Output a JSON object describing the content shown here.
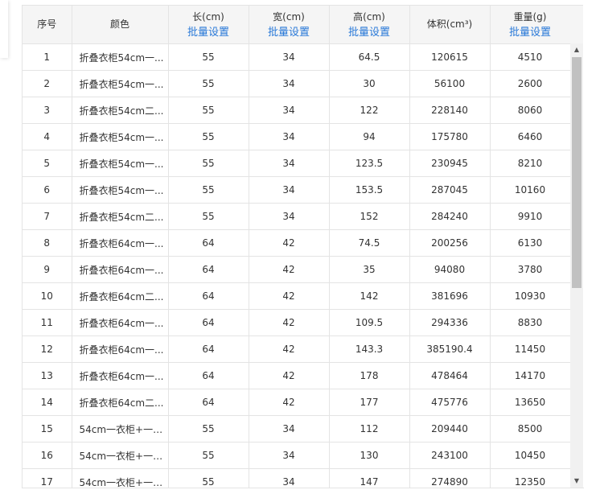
{
  "header": {
    "index": "序号",
    "color": "颜色",
    "length": "长(cm)",
    "width": "宽(cm)",
    "height": "高(cm)",
    "volume": "体积(cm³)",
    "weight": "重量(g)",
    "batch_label": "批量设置"
  },
  "rows": [
    {
      "index": "1",
      "color": "折叠衣柜54cm一...",
      "length": "55",
      "width": "34",
      "height": "64.5",
      "volume": "120615",
      "weight": "4510"
    },
    {
      "index": "2",
      "color": "折叠衣柜54cm一...",
      "length": "55",
      "width": "34",
      "height": "30",
      "volume": "56100",
      "weight": "2600"
    },
    {
      "index": "3",
      "color": "折叠衣柜54cm二...",
      "length": "55",
      "width": "34",
      "height": "122",
      "volume": "228140",
      "weight": "8060"
    },
    {
      "index": "4",
      "color": "折叠衣柜54cm一...",
      "length": "55",
      "width": "34",
      "height": "94",
      "volume": "175780",
      "weight": "6460"
    },
    {
      "index": "5",
      "color": "折叠衣柜54cm一...",
      "length": "55",
      "width": "34",
      "height": "123.5",
      "volume": "230945",
      "weight": "8210"
    },
    {
      "index": "6",
      "color": "折叠衣柜54cm一...",
      "length": "55",
      "width": "34",
      "height": "153.5",
      "volume": "287045",
      "weight": "10160"
    },
    {
      "index": "7",
      "color": "折叠衣柜54cm二...",
      "length": "55",
      "width": "34",
      "height": "152",
      "volume": "284240",
      "weight": "9910"
    },
    {
      "index": "8",
      "color": "折叠衣柜64cm一...",
      "length": "64",
      "width": "42",
      "height": "74.5",
      "volume": "200256",
      "weight": "6130"
    },
    {
      "index": "9",
      "color": "折叠衣柜64cm一...",
      "length": "64",
      "width": "42",
      "height": "35",
      "volume": "94080",
      "weight": "3780"
    },
    {
      "index": "10",
      "color": "折叠衣柜64cm二...",
      "length": "64",
      "width": "42",
      "height": "142",
      "volume": "381696",
      "weight": "10930"
    },
    {
      "index": "11",
      "color": "折叠衣柜64cm一...",
      "length": "64",
      "width": "42",
      "height": "109.5",
      "volume": "294336",
      "weight": "8830"
    },
    {
      "index": "12",
      "color": "折叠衣柜64cm一...",
      "length": "64",
      "width": "42",
      "height": "143.3",
      "volume": "385190.4",
      "weight": "11450"
    },
    {
      "index": "13",
      "color": "折叠衣柜64cm一...",
      "length": "64",
      "width": "42",
      "height": "178",
      "volume": "478464",
      "weight": "14170"
    },
    {
      "index": "14",
      "color": "折叠衣柜64cm二...",
      "length": "64",
      "width": "42",
      "height": "177",
      "volume": "475776",
      "weight": "13650"
    },
    {
      "index": "15",
      "color": "54cm一衣柜+一折...",
      "length": "55",
      "width": "34",
      "height": "112",
      "volume": "209440",
      "weight": "8500"
    },
    {
      "index": "16",
      "color": "54cm一衣柜+一折...",
      "length": "55",
      "width": "34",
      "height": "130",
      "volume": "243100",
      "weight": "10450"
    },
    {
      "index": "17",
      "color": "54cm一衣柜+一折...",
      "length": "55",
      "width": "34",
      "height": "147",
      "volume": "274890",
      "weight": "12350"
    }
  ],
  "scrollbar": {
    "up_icon": "triangle-up-icon",
    "down_icon": "triangle-down-icon",
    "up_glyph": "▲",
    "down_glyph": "▼"
  },
  "colors": {
    "link": "#2878d8",
    "header_bg": "#f5f5f5",
    "border": "#e4e4e4",
    "text": "#333333"
  }
}
